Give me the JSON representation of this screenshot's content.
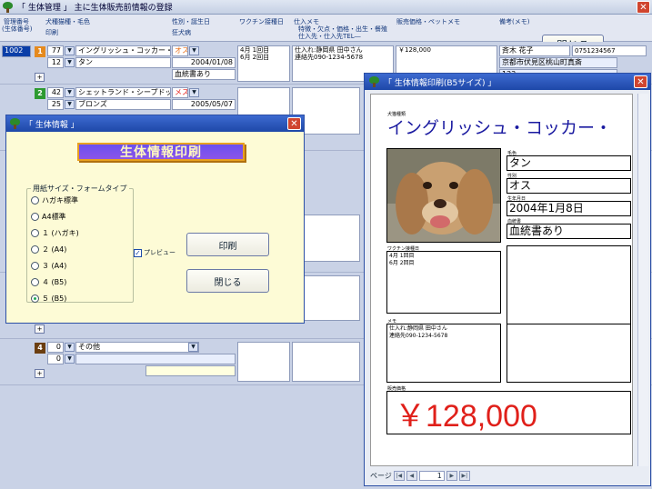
{
  "main": {
    "title": "「 生体管理 」 主に生体販売前情報の登録",
    "close_label": "閉じる",
    "headers": {
      "mgmt_no": "管理番号",
      "mgmt_no2": "(生体番号)",
      "breed_color": "犬種猫種・毛色",
      "print": "印刷",
      "sex_birth": "性別・誕生日",
      "kennel": "狂犬病",
      "vaccine_date": "ワクチン接種日",
      "purchase_memo": "仕入メモ",
      "purchase_memo2": "特徴・欠点・価格・出生・餐殖",
      "purchase_memo3": "仕入先・仕入先TEL―",
      "sale": "販売価格・ペットメモ",
      "remarks": "備考(メモ)"
    },
    "rows": [
      {
        "mgmt_no": "1002",
        "num": "1",
        "breed_code": "77",
        "breed": "イングリッシュ・コッカー・スパ",
        "color_code": "12",
        "color": "タン",
        "sex": "オス",
        "birth": "2004/01/08",
        "kennel": "血統書あり",
        "vaccine1": "4月 1回目",
        "vaccine2": "6月 2回目",
        "memo1": "仕入れ:静岡県 田中さん",
        "memo2": "連絡先090-1234-5678",
        "price": "￥128,000",
        "owner": "斉木 花子",
        "phone": "0751234567",
        "addr": "京都市伏見区桃山町真斎",
        "addr2": "123"
      },
      {
        "num": "2",
        "breed_code": "42",
        "breed": "シェットランド・シープドッグ",
        "color_code": "25",
        "color": "ブロンズ",
        "sex": "メス",
        "birth": "2005/05/07"
      },
      {
        "num": "4",
        "breed_code": "0",
        "breed": "その他",
        "color_code": "0",
        "color": ""
      }
    ]
  },
  "dialog": {
    "title": "「 生体情報 」",
    "banner": "生体情報印刷",
    "group_label": "用紙サイズ・フォームタイプ",
    "options": [
      "ハガキ標準",
      "A4標準",
      "１ (ハガキ)",
      "２ (A4)",
      "３ (A4)",
      "４ (B5)",
      "５ (B5)"
    ],
    "selected_index": 6,
    "preview_label": "プレビュー",
    "preview_checked": true,
    "print_label": "印刷",
    "close_label": "閉じる"
  },
  "preview": {
    "title": "「 生体情報印刷(B5サイズ) 」",
    "breed_caption": "犬猫種類",
    "breed": "イングリッシュ・コッカー・",
    "color_caption": "毛色",
    "color": "タン",
    "sex_caption": "性別",
    "sex": "オス",
    "birth_caption": "生年月日",
    "birth": "2004年1月8日",
    "pedigree_caption": "血統書",
    "pedigree": "血統書あり",
    "vaccine_caption": "ワクチン接種日",
    "vaccine1": "4月 1回目",
    "vaccine2": "6月 2回目",
    "memo_caption": "メモ",
    "memo1": "仕入れ:静岡県 田中さん",
    "memo2": "連絡先090-1234-5678",
    "price_caption": "販売価格",
    "price": "￥128,000",
    "page_label": "ページ",
    "page_value": "1",
    "colors": {
      "title": "#1a1aa0",
      "price": "#e0201a"
    }
  }
}
